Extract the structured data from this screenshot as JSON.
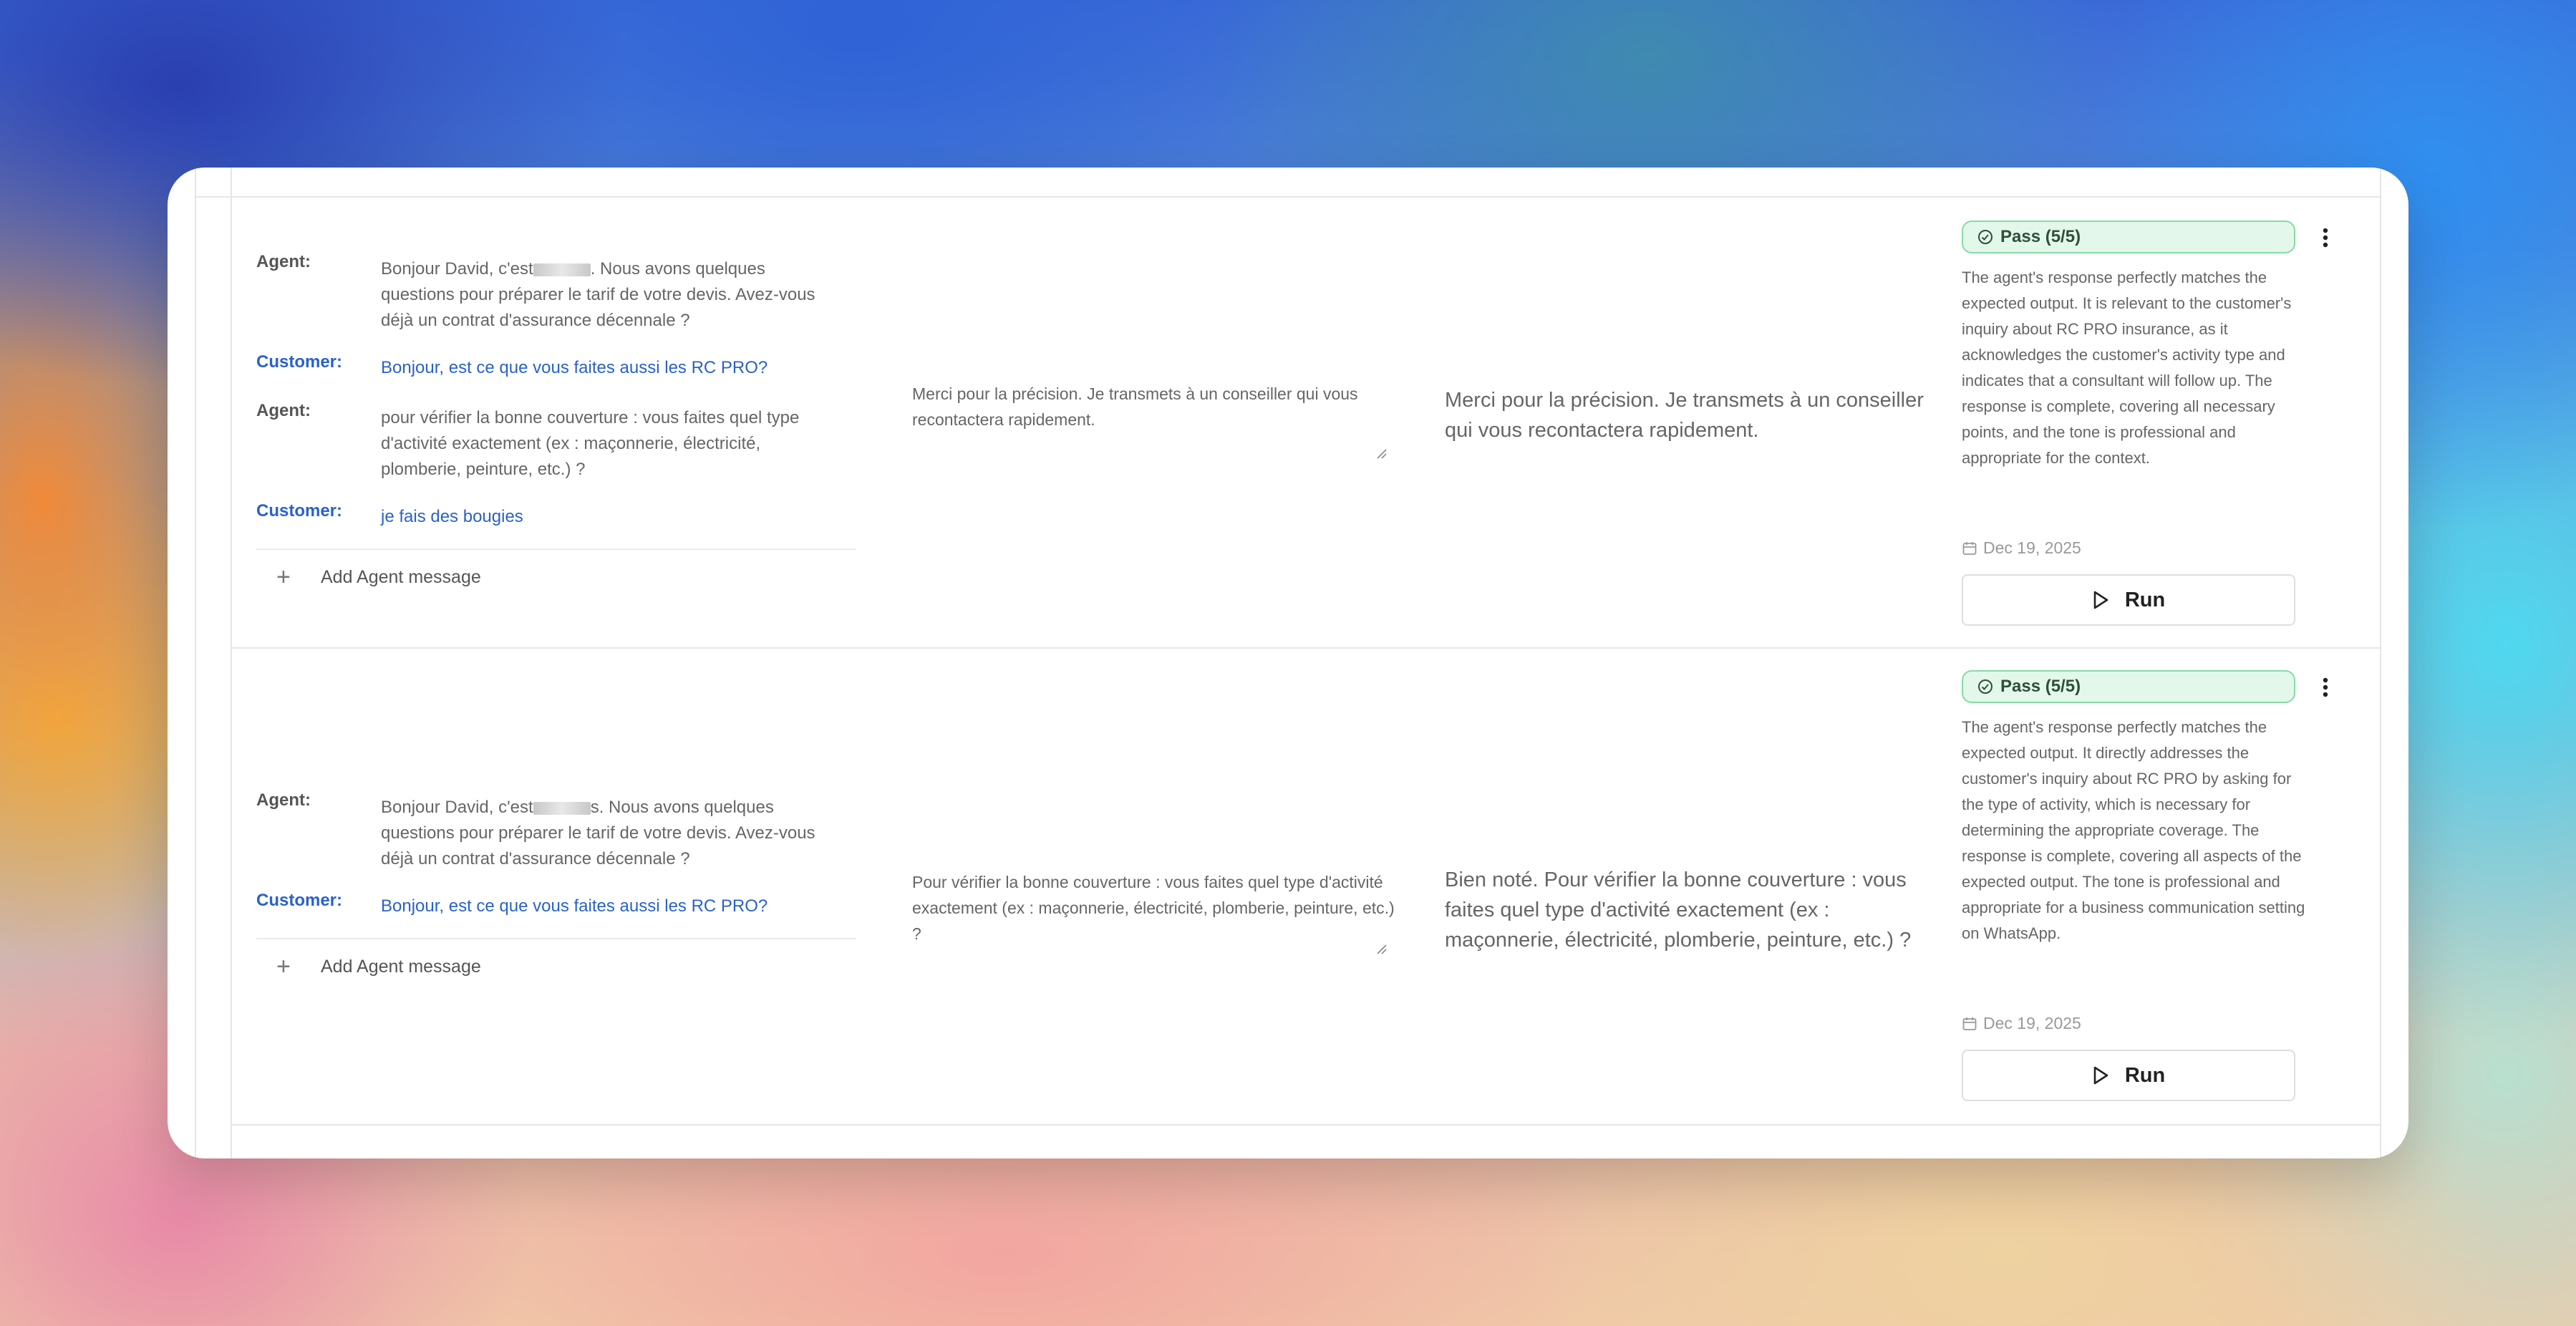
{
  "rows": [
    {
      "messages": [
        {
          "role": "Agent:",
          "text_before": "Bonjour David, c'est",
          "text_after": ". Nous avons quelques questions pour préparer le tarif de votre devis. Avez-vous déjà un contrat d'assurance décennale ?"
        },
        {
          "role": "Customer:",
          "text": "Bonjour, est ce que vous faites aussi les RC PRO?"
        },
        {
          "role": "Agent:",
          "text": "pour vérifier la bonne couverture : vous faites quel type d'activité exactement (ex : maçonnerie, électricité, plomberie, peinture, etc.) ?"
        },
        {
          "role": "Customer:",
          "text": "je fais des bougies"
        }
      ],
      "add_message_label": "Add Agent message",
      "actual_output": "Merci pour la précision. Je transmets à un conseiller qui vous recontactera rapidement.",
      "expected_output": "Merci pour la précision. Je transmets à un conseiller qui vous recontactera rapidement.",
      "badge": "Pass (5/5)",
      "reason": "The agent's response perfectly matches the expected output. It is relevant to the customer's inquiry about RC PRO insurance, as it acknowledges the customer's activity type and indicates that a consultant will follow up. The response is complete, covering all necessary points, and the tone is professional and appropriate for the context.",
      "date": "Dec 19, 2025",
      "run_label": "Run"
    },
    {
      "messages": [
        {
          "role": "Agent:",
          "text_before": "Bonjour David, c'est",
          "text_after": "s. Nous avons quelques questions pour préparer le tarif de votre devis. Avez-vous déjà un contrat d'assurance décennale ?"
        },
        {
          "role": "Customer:",
          "text": "Bonjour, est ce que vous faites aussi les RC PRO?"
        }
      ],
      "add_message_label": "Add Agent message",
      "actual_output": "Pour vérifier la bonne couverture : vous faites quel type d'activité exactement (ex : maçonnerie, électricité, plomberie, peinture, etc.) ?",
      "expected_output": "Bien noté. Pour vérifier la bonne couverture : vous faites quel type d'activité exactement (ex : maçonnerie, électricité, plomberie, peinture, etc.) ?",
      "badge": "Pass (5/5)",
      "reason": "The agent's response perfectly matches the expected output. It directly addresses the customer's inquiry about RC PRO by asking for the type of activity, which is necessary for determining the appropriate coverage. The response is complete, covering all aspects of the expected output. The tone is professional and appropriate for a business communication setting on WhatsApp.",
      "date": "Dec 19, 2025",
      "run_label": "Run"
    }
  ],
  "colors": {
    "customer_text": "#2a62c9",
    "badge_bg": "#e3f8ea",
    "badge_border": "#86dca3"
  },
  "icons": [
    "plus-icon",
    "check-circle-icon",
    "kebab-menu-icon",
    "calendar-icon",
    "play-icon",
    "resize-handle-icon"
  ]
}
